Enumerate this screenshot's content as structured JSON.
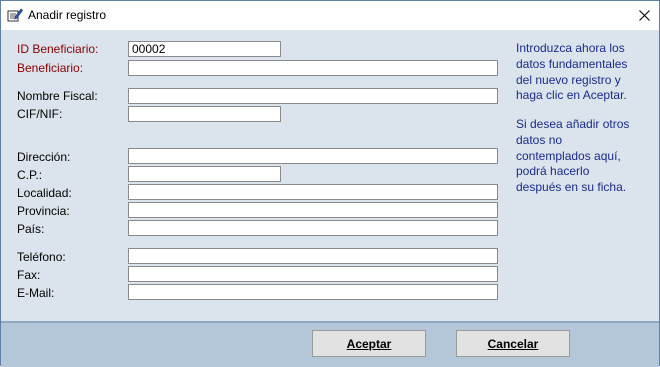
{
  "window": {
    "title": "Anadir registro",
    "icon": "edit-document-icon",
    "close_icon": "close-icon"
  },
  "form": {
    "id_beneficiario": {
      "label": "ID Beneficiario:",
      "value": "00002"
    },
    "beneficiario": {
      "label": "Beneficiario:",
      "value": ""
    },
    "nombre_fiscal": {
      "label": "Nombre Fiscal:",
      "value": ""
    },
    "cif_nif": {
      "label": "CIF/NIF:",
      "value": ""
    },
    "direccion": {
      "label": "Dirección:",
      "value": ""
    },
    "cp": {
      "label": "C.P.:",
      "value": ""
    },
    "localidad": {
      "label": "Localidad:",
      "value": ""
    },
    "provincia": {
      "label": "Provincia:",
      "value": ""
    },
    "pais": {
      "label": "País:",
      "value": ""
    },
    "telefono": {
      "label": "Teléfono:",
      "value": ""
    },
    "fax": {
      "label": "Fax:",
      "value": ""
    },
    "email": {
      "label": "E-Mail:",
      "value": ""
    }
  },
  "info": {
    "paragraph1": "Introduzca ahora los datos fundamentales del nuevo registro y haga clic en Aceptar.",
    "paragraph2": "Si desea añadir otros datos no contemplados aquí, podrá hacerlo después en su ficha."
  },
  "buttons": {
    "accept": "Aceptar",
    "cancel": "Cancelar"
  },
  "colors": {
    "client_bg": "#dbe4ec",
    "footer_bg": "#b4c7d8",
    "required_label": "#8b0000",
    "info_text": "#1a2a8e"
  }
}
